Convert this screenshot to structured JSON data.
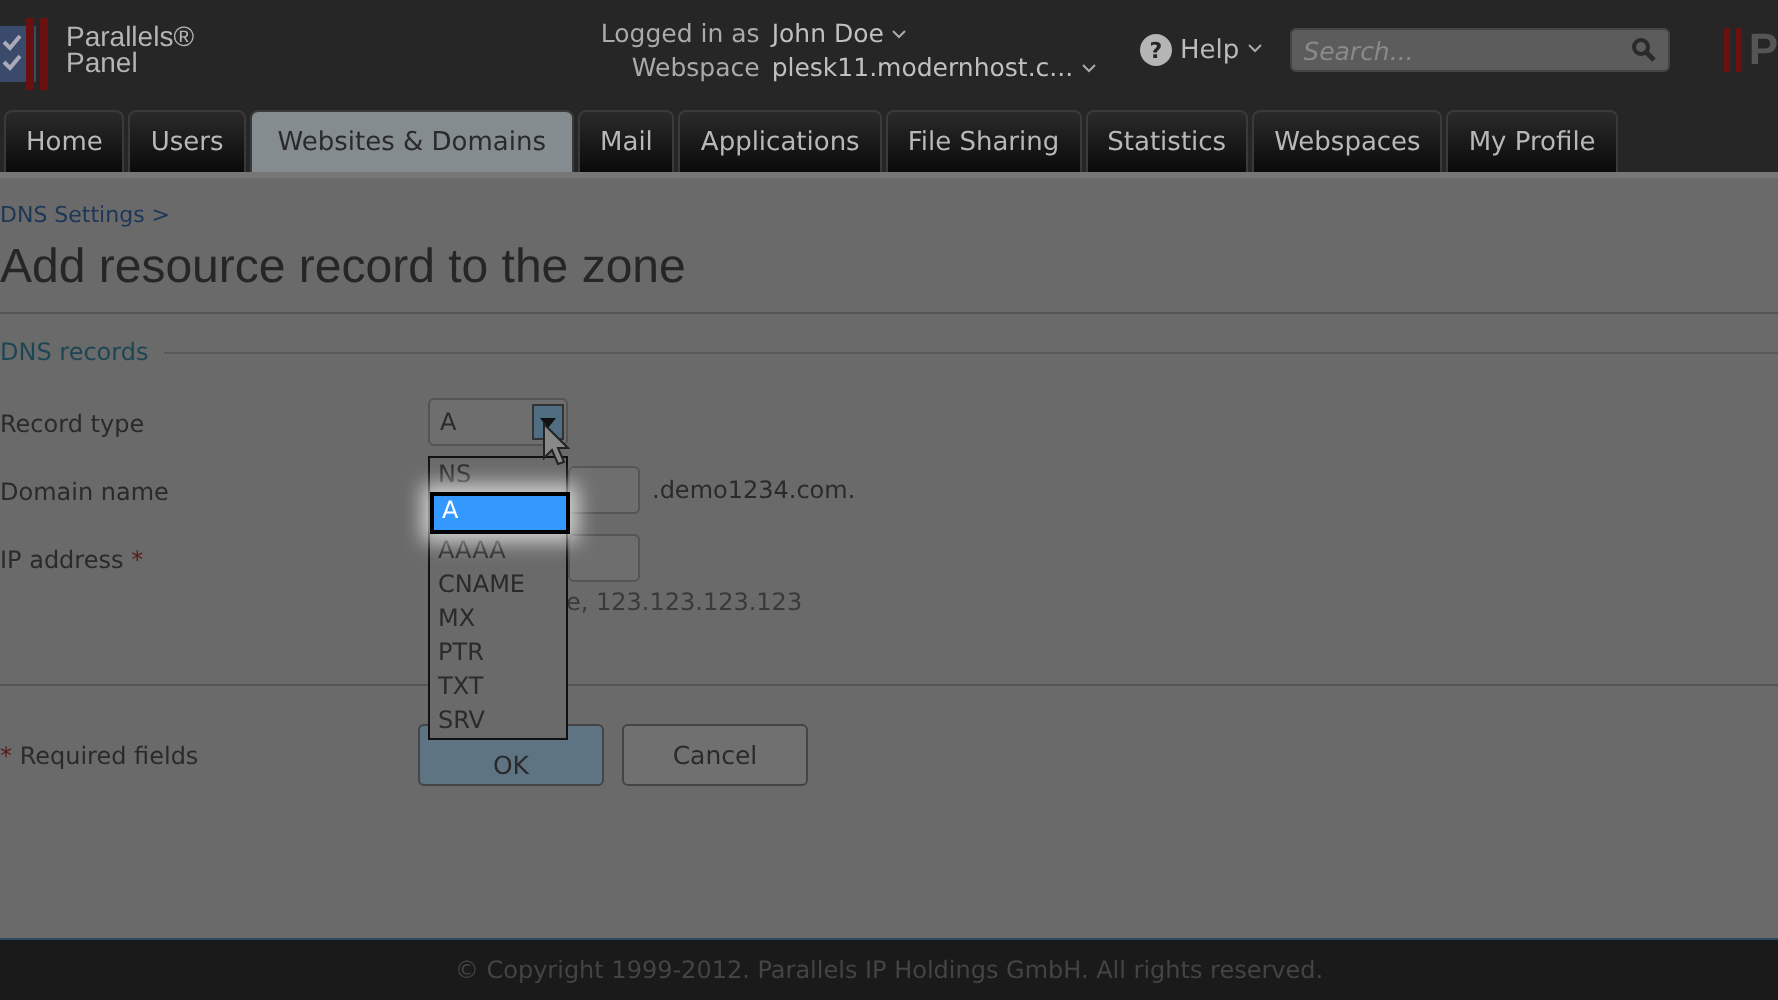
{
  "header": {
    "logo_text": [
      "Parallels®",
      "Panel"
    ],
    "logged_in_label": "Logged in as",
    "user": "John Doe",
    "webspace_label": "Webspace",
    "webspace": "plesk11.modernhost.c...",
    "help_icon": "?",
    "help": "Help",
    "search": {
      "placeholder": "Search..."
    },
    "right_logo": "P"
  },
  "tabs": [
    {
      "label": "Home",
      "selected": false
    },
    {
      "label": "Users",
      "selected": false
    },
    {
      "label": "Websites & Domains",
      "selected": true
    },
    {
      "label": "Mail",
      "selected": false
    },
    {
      "label": "Applications",
      "selected": false
    },
    {
      "label": "File Sharing",
      "selected": false
    },
    {
      "label": "Statistics",
      "selected": false
    },
    {
      "label": "Webspaces",
      "selected": false
    },
    {
      "label": "My Profile",
      "selected": false
    }
  ],
  "breadcrumb": "DNS Settings >",
  "title": "Add resource record to the zone",
  "section": "DNS records",
  "form": {
    "record_type": {
      "label": "Record type",
      "value": "A",
      "options": [
        {
          "label": "NS",
          "selected": false
        },
        {
          "label": "A",
          "selected": true
        },
        {
          "label": "AAAA",
          "selected": false
        },
        {
          "label": "CNAME",
          "selected": false
        },
        {
          "label": "MX",
          "selected": false
        },
        {
          "label": "PTR",
          "selected": false
        },
        {
          "label": "TXT",
          "selected": false
        },
        {
          "label": "SRV",
          "selected": false
        }
      ]
    },
    "domain_name": {
      "label": "Domain name",
      "suffix": ".demo1234.com."
    },
    "ip_address": {
      "label": "IP address",
      "required_mark": "*",
      "hint": "e, 123.123.123.123"
    }
  },
  "required_note": {
    "mark": "*",
    "text": "Required fields"
  },
  "buttons": [
    {
      "label": "OK",
      "kind": "primary"
    },
    {
      "label": "Cancel",
      "kind": "secondary"
    }
  ],
  "footer": "© Copyright 1999-2012. Parallels IP Holdings GmbH. All rights reserved."
}
